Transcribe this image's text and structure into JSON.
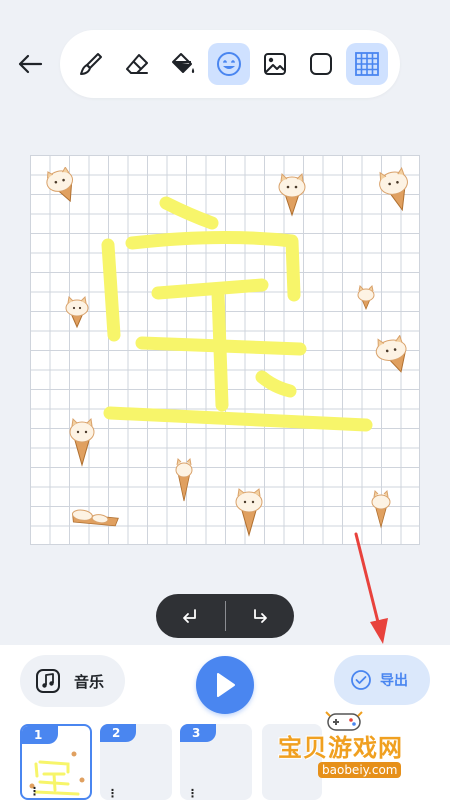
{
  "toolbar": {
    "tools": [
      {
        "name": "brush-icon",
        "active": false
      },
      {
        "name": "eraser-icon",
        "active": false
      },
      {
        "name": "paint-bucket-icon",
        "active": false
      },
      {
        "name": "sticker-icon",
        "active": true
      },
      {
        "name": "image-icon",
        "active": false
      },
      {
        "name": "background-shape-icon",
        "active": false
      },
      {
        "name": "grid-icon",
        "active": true
      }
    ]
  },
  "canvas": {
    "drawn_character": "宝",
    "stroke_color": "#f7f56a",
    "sticker": "cat-ice-cream-sticker"
  },
  "history": {
    "undo_icon": "undo-icon",
    "redo_icon": "redo-icon"
  },
  "bottom": {
    "music_label": "音乐",
    "export_label": "导出",
    "play_icon": "play-icon"
  },
  "frames": [
    {
      "number": "1",
      "selected": true
    },
    {
      "number": "2",
      "selected": false
    },
    {
      "number": "3",
      "selected": false
    }
  ],
  "watermark": {
    "text": "宝贝游戏网",
    "url": "baobeiy.com"
  },
  "colors": {
    "accent": "#4a86f0",
    "active_tool_bg": "#cfe1ff",
    "arrow": "#e8423c"
  }
}
